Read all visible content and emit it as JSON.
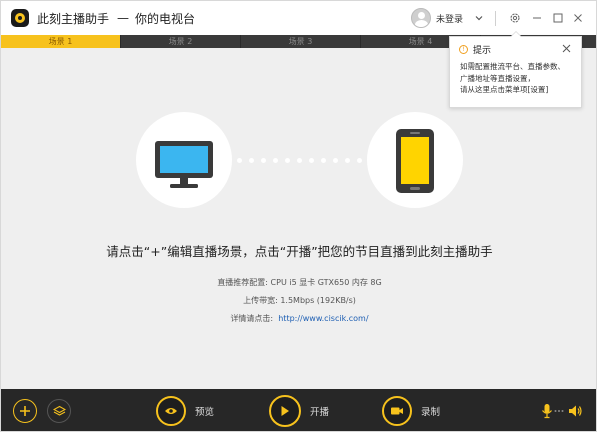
{
  "titlebar": {
    "app_name": "此刻主播助手",
    "separator": "—",
    "channel_name": "你的电视台",
    "user_label": "未登录"
  },
  "tabs": [
    {
      "label": "场景 1",
      "active": true
    },
    {
      "label": "场景 2",
      "active": false
    },
    {
      "label": "场景 3",
      "active": false
    },
    {
      "label": "场景 4",
      "active": false
    }
  ],
  "popup": {
    "title": "提示",
    "lines": [
      "如需配置推流平台、直播参数、",
      "广播地址等直播设置，",
      "请从这里点击菜单项[设置]"
    ]
  },
  "main": {
    "headline": "请点击“+”编辑直播场景，点击“开播”把您的节目直播到此刻主播助手",
    "config_text": "直播推荐配置: CPU i5  显卡 GTX650  内存 8G",
    "bandwidth_text": "上传带宽: 1.5Mbps (192KB/s)",
    "details_label": "详情请点击:",
    "details_link": "http://www.ciscik.com/"
  },
  "bottombar": {
    "preview_label": "预览",
    "live_label": "开播",
    "record_label": "录制"
  },
  "colors": {
    "accent": "#f7c21d",
    "monitor_screen": "#3bb6f0",
    "phone_screen": "#ffd400",
    "icon_dark": "#3a3a3a",
    "bottom_bar": "#272727",
    "link": "#1e5fb3"
  },
  "icons": {
    "logo": "app-logo-icon",
    "avatar": "user-avatar-icon",
    "dropdown": "chevron-down-icon",
    "settings": "gear-icon",
    "minimize": "minimize-icon",
    "maximize": "maximize-icon",
    "close": "close-icon",
    "info": "info-icon",
    "monitor": "monitor-icon",
    "phone": "phone-icon",
    "add": "plus-icon",
    "layers": "layers-icon",
    "preview": "eye-icon",
    "live": "play-icon",
    "record": "video-camera-icon",
    "mic": "microphone-icon",
    "speaker": "speaker-icon"
  }
}
